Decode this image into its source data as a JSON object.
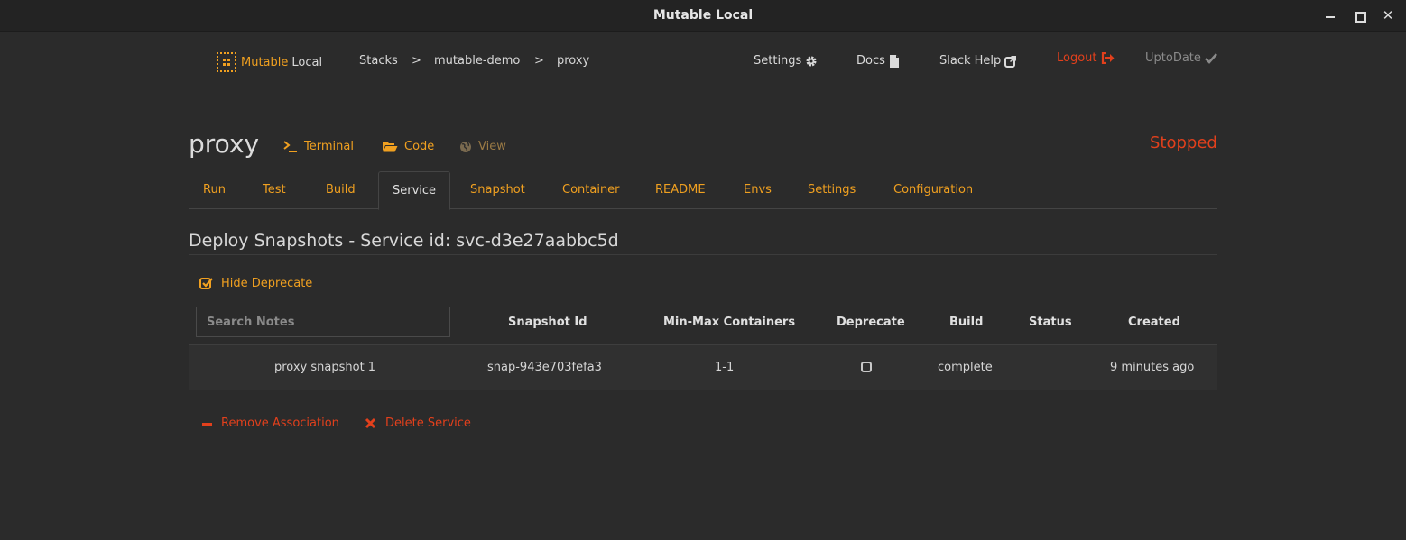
{
  "window": {
    "title": "Mutable Local",
    "close_glyph": "✕"
  },
  "nav": {
    "brand_primary": "Mutable",
    "brand_secondary": "Local",
    "breadcrumbs": [
      {
        "label": "Stacks"
      },
      {
        "label": ">"
      },
      {
        "label": "mutable-demo"
      },
      {
        "label": ">"
      },
      {
        "label": "proxy"
      }
    ],
    "links": {
      "settings": "Settings",
      "docs": "Docs",
      "slack_help": "Slack Help",
      "logout": "Logout",
      "uptodate": "UptoDate"
    }
  },
  "header": {
    "title": "proxy",
    "actions": {
      "terminal": "Terminal",
      "code": "Code",
      "view": "View"
    },
    "status": "Stopped"
  },
  "tabs": [
    {
      "label": "Run"
    },
    {
      "label": "Test"
    },
    {
      "label": "Build"
    },
    {
      "label": "Service",
      "active": true
    },
    {
      "label": "Snapshot"
    },
    {
      "label": "Container"
    },
    {
      "label": "README"
    },
    {
      "label": "Envs"
    },
    {
      "label": "Settings"
    },
    {
      "label": "Configuration"
    }
  ],
  "section": {
    "title": "Deploy Snapshots - Service id: svc-d3e27aabbc5d",
    "hide_deprecate": "Hide Deprecate"
  },
  "table": {
    "search_placeholder": "Search Notes",
    "columns": {
      "snapshot_id": "Snapshot Id",
      "min_max": "Min-Max Containers",
      "deprecate": "Deprecate",
      "build": "Build",
      "status": "Status",
      "created": "Created"
    },
    "rows": [
      {
        "notes": "proxy snapshot 1",
        "snapshot_id": "snap-943e703fefa3",
        "min_max": "1-1",
        "deprecate": false,
        "build": "complete",
        "status": "",
        "created": "9 minutes ago"
      }
    ]
  },
  "footer": {
    "remove_association": "Remove Association",
    "delete_service": "Delete Service"
  },
  "colors": {
    "accent": "#f0a020",
    "danger": "#e2401c",
    "background": "#2b2b2b",
    "titlebar": "#232323"
  }
}
